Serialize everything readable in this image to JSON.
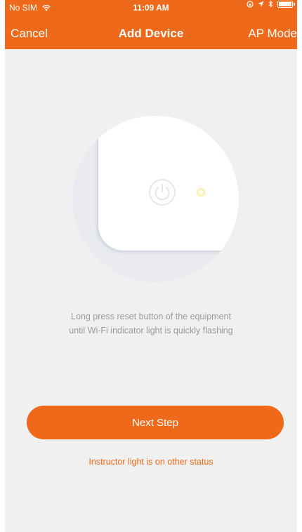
{
  "status_bar": {
    "carrier": "No SIM",
    "time": "11:09 AM",
    "icons": [
      "wifi-icon",
      "orientation-lock-icon",
      "location-icon",
      "bluetooth-icon",
      "battery-icon"
    ]
  },
  "nav": {
    "cancel_label": "Cancel",
    "title": "Add Device",
    "ap_mode_label": "AP Mode"
  },
  "illustration": {
    "icons": [
      "power-icon",
      "wifi-indicator-light"
    ]
  },
  "instructions": {
    "line1": "Long press reset button of the equipment",
    "line2": "until Wi-Fi indicator light is quickly flashing"
  },
  "actions": {
    "next_step_label": "Next Step",
    "other_status_label": "Instructor light is on other status"
  },
  "colors": {
    "accent": "#ee6a1a",
    "background": "#f0f0f0",
    "hint_text": "#9a9a9a"
  }
}
